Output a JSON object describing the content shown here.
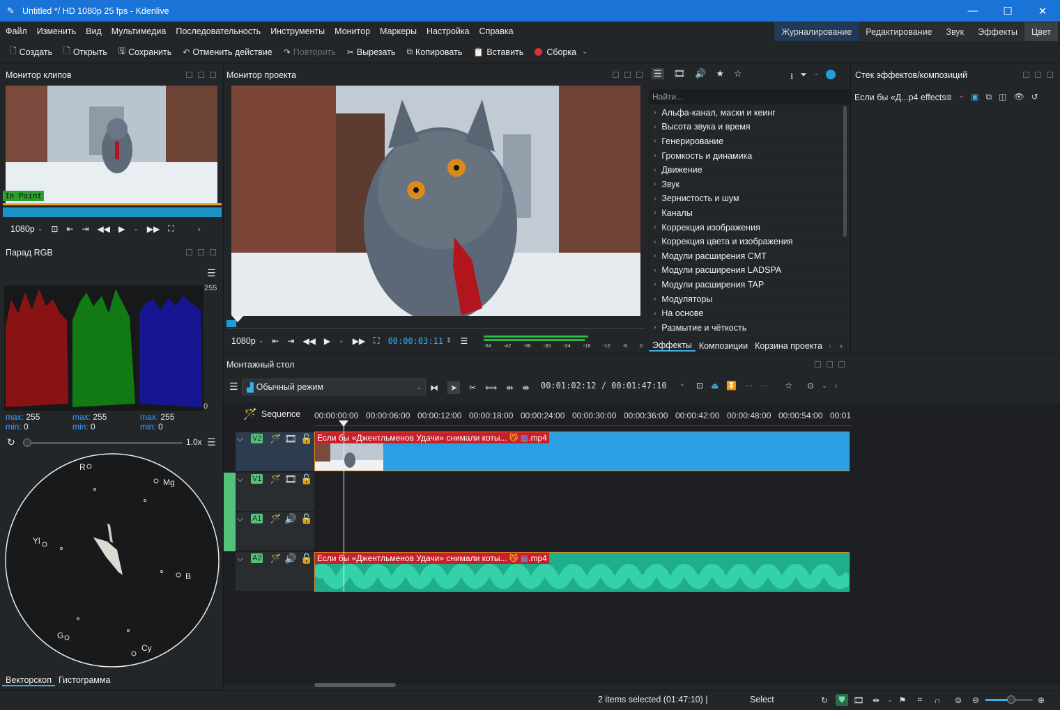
{
  "window": {
    "title": "Untitled */ HD 1080p 25 fps - Kdenlive",
    "minimize": "—",
    "maximize": "☐",
    "close": "✕"
  },
  "menu": [
    "Файл",
    "Изменить",
    "Вид",
    "Мультимедиа",
    "Последовательность",
    "Инструменты",
    "Монитор",
    "Маркеры",
    "Настройка",
    "Справка"
  ],
  "workspaces": [
    "Журналирование",
    "Редактирование",
    "Звук",
    "Эффекты",
    "Цвет"
  ],
  "toolbar": {
    "create": "Создать",
    "open": "Открыть",
    "save": "Сохранить",
    "undo": "Отменить действие",
    "redo": "Повторить",
    "cut": "Вырезать",
    "copy": "Копировать",
    "paste": "Вставить",
    "render": "Сборка"
  },
  "clip_monitor": {
    "title": "Монитор клипов",
    "in_point": "In Point",
    "resolution": "1080p"
  },
  "project_monitor": {
    "title": "Монитор проекта",
    "resolution": "1080p",
    "timecode": "00:00:03:11",
    "meter_labels": [
      "-54",
      "-42",
      "-36",
      "-30",
      "-24",
      "-18",
      "-12",
      "-6",
      "0"
    ]
  },
  "rgb_parade": {
    "title": "Парад RGB",
    "top": "255",
    "bottom": "0",
    "stats": [
      {
        "max_label": "max:",
        "max": "255",
        "min_label": "min:",
        "min": "0"
      },
      {
        "max_label": "max:",
        "max": "255",
        "min_label": "min:",
        "min": "0"
      },
      {
        "max_label": "max:",
        "max": "255",
        "min_label": "min:",
        "min": "0"
      }
    ]
  },
  "vectorscope": {
    "zoom": "1.0x",
    "labels": {
      "r": "R",
      "mg": "Mg",
      "yl": "Yl",
      "b": "B",
      "g": "G",
      "cy": "Cy"
    }
  },
  "scope_tabs": [
    "Векторскоп",
    "Гистограмма"
  ],
  "effects": {
    "search_placeholder": "Найти...",
    "items": [
      "Альфа-канал, маски и кеинг",
      "Высота звука и время",
      "Генерирование",
      "Громкость и динамика",
      "Движение",
      "Звук",
      "Зернистость и шум",
      "Каналы",
      "Коррекция изображения",
      "Коррекция цвета и изображения",
      "Модули расширения CMT",
      "Модули расширения LADSPA",
      "Модули расширения TAP",
      "Модуляторы",
      "На основе",
      "Размытие и чёткость"
    ],
    "tabs": [
      "Эффекты",
      "Композиции",
      "Корзина проекта"
    ]
  },
  "effect_stack": {
    "title": "Стек эффектов/композиций",
    "clip": "Если бы «Д...р4 effects"
  },
  "timeline": {
    "title": "Монтажный стол",
    "mode": "Обычный режим",
    "timecode": "00:01:02:12 / 00:01:47:10",
    "sequence": "Sequence",
    "ruler": [
      "00:00:00:00",
      "00:00:06:00",
      "00:00:12:00",
      "00:00:18:00",
      "00:00:24:00",
      "00:00:30:00",
      "00:00:36:00",
      "00:00:42:00",
      "00:00:48:00",
      "00:00:54:00",
      "00:01"
    ],
    "tracks": [
      "V2",
      "V1",
      "A1",
      "A2"
    ],
    "clip_name": "Если бы «Джентльменов Удачи» снимали коты...",
    "clip_ext": ".mp4"
  },
  "status": {
    "selection": "2 items selected (01:47:10) |",
    "tool": "Select"
  },
  "colors": {
    "accent": "#1a73d6",
    "clip_video": "#2a9fe6",
    "clip_audio": "#1fae8c",
    "label_red": "#c8202a",
    "track_tag": "#55c27a"
  }
}
